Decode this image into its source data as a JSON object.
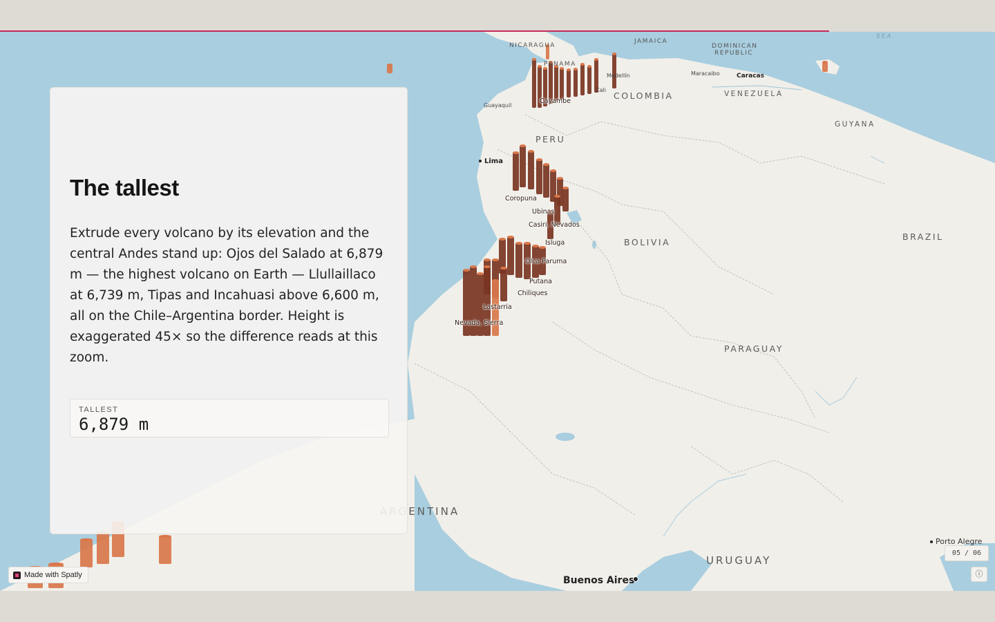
{
  "progress_fraction": 0.833,
  "panel": {
    "title": "The tallest",
    "body": "Extrude every volcano by its elevation and the central Andes stand up: Ojos del Salado at 6,879 m — the highest volcano on Earth — Llullaillaco at 6,739 m, Tipas and Incahuasi above 6,600 m, all on the Chile–Argentina border. Height is exaggerated 45× so the difference reads at this zoom.",
    "stat_label": "TALLEST",
    "stat_value": "6,879 m"
  },
  "badge": {
    "label": "Made with Spatly"
  },
  "pager": {
    "text": "05 / 06"
  },
  "info_icon": "info-icon",
  "map": {
    "countries": {
      "colombia": "COLOMBIA",
      "venezuela": "VENEZUELA",
      "guyana": "GUYANA",
      "peru": "PERU",
      "bolivia": "BOLIVIA",
      "brazil": "BRAZIL",
      "paraguay": "PARAGUAY",
      "argentina": "ARGENTINA",
      "uruguay": "URUGUAY",
      "panama": "PANAMA",
      "nicaragua": "NICARAGUA",
      "jamaica": "JAMAICA",
      "dominican_republic": "DOMINICAN REPUBLIC"
    },
    "cities": {
      "lima": "Lima",
      "caracas": "Caracas",
      "maracaibo": "Maracaibo",
      "guayaquil": "Guayaquil",
      "medellin": "Medellín",
      "cali": "Cali",
      "buenos_aires": "Buenos Aires",
      "porto_alegre": "Porto Alegre"
    },
    "sea": "SEA",
    "volcanoes": {
      "cayambe": "Cayambe",
      "coropuna": "Coropuna",
      "ubinas": "Ubinas",
      "casiri": "Casiri, Nevados",
      "isluga": "Isluga",
      "olca": "Olca Paruma",
      "putana": "Putana",
      "chiliques": "Chiliques",
      "lastarria": "Lastarria",
      "nevada": "Nevada, Sierra"
    },
    "colors": {
      "water": "#a9cedf",
      "land": "#f1efea",
      "column_dark": "#7a3522",
      "column_light": "#d9774a"
    }
  }
}
